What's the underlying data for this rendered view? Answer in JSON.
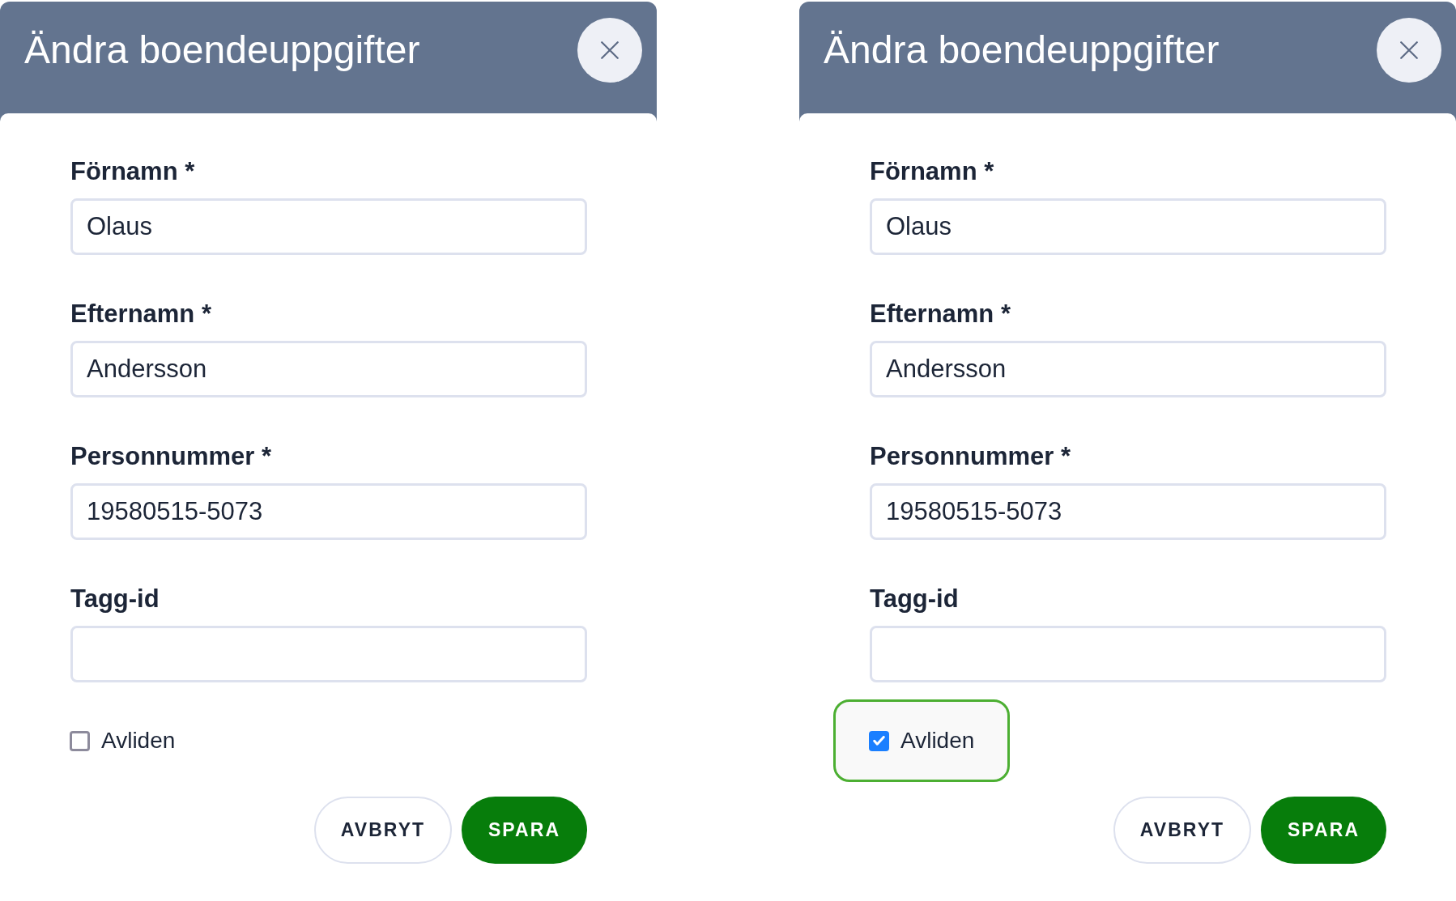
{
  "dialogs": [
    {
      "title": "Ändra boendeuppgifter",
      "fields": [
        {
          "label": "Förnamn *",
          "value": "Olaus"
        },
        {
          "label": "Efternamn *",
          "value": "Andersson"
        },
        {
          "label": "Personnummer *",
          "value": "19580515-5073"
        },
        {
          "label": "Tagg-id"
        }
      ],
      "checkbox": {
        "label": "Avliden",
        "checked": false,
        "focused": false
      },
      "buttons": [
        {
          "label": "AVBRYT",
          "kind": "secondary"
        },
        {
          "label": "SPARA",
          "kind": "primary"
        }
      ]
    },
    {
      "title": "Ändra boendeuppgifter",
      "fields": [
        {
          "label": "Förnamn *",
          "value": "Olaus"
        },
        {
          "label": "Efternamn *",
          "value": "Andersson"
        },
        {
          "label": "Personnummer *",
          "value": "19580515-5073"
        },
        {
          "label": "Tagg-id"
        }
      ],
      "checkbox": {
        "label": "Avliden",
        "checked": true,
        "focused": true
      },
      "buttons": [
        {
          "label": "AVBRYT",
          "kind": "secondary"
        },
        {
          "label": "SPARA",
          "kind": "primary"
        }
      ]
    }
  ]
}
